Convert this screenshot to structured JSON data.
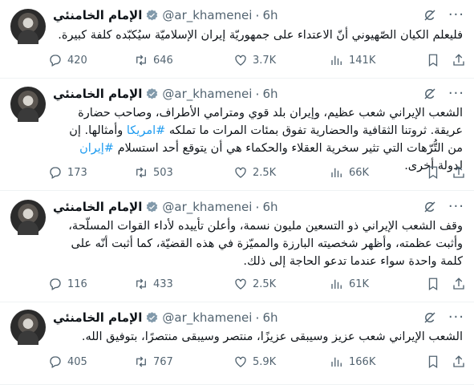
{
  "tweets": [
    {
      "name": "الإمام الخامنئي",
      "handle": "@ar_khamenei",
      "time": "6h",
      "text": "فليعلم الكيان الصّهيوني أنّ الاعتداء على جمهوريّة إيران الإسلاميّة سيُكبّده كلفة كبيرة.",
      "hashtags": [],
      "replies": "420",
      "retweets": "646",
      "likes": "3.7K",
      "views": "141K"
    },
    {
      "name": "الإمام الخامنئي",
      "handle": "@ar_khamenei",
      "time": "6h",
      "text_parts": [
        "الشعب الإيراني شعب عظيم، وإيران بلد قوي ومترامي الأطراف، وصاحب حضارة عريقة. ثروتنا الثقافية والحضارية تفوق بمئات المرات ما تملكه ",
        "#امريكا",
        " وأمثالها. إن من التُّرّهات التي تثير سخرية العقلاء والحكماء هي أن يتوقع أحد استسلام ",
        "#إيران",
        " لدولة أخرى."
      ],
      "replies": "173",
      "retweets": "503",
      "likes": "2.5K",
      "views": "66K"
    },
    {
      "name": "الإمام الخامنئي",
      "handle": "@ar_khamenei",
      "time": "6h",
      "text": "وقف الشعب الإيراني ذو التسعين مليون نسمة، وأعلن تأييده لأداء القوات المسلّحة، وأثبت عظمته، وأظهر شخصيته البارزة والمميّزة في هذه القضيّة، كما أثبت أنّه على كلمة واحدة سواء عندما تدعو الحاجة إلى ذلك.",
      "replies": "116",
      "retweets": "433",
      "likes": "2.5K",
      "views": "61K"
    },
    {
      "name": "الإمام الخامنئي",
      "handle": "@ar_khamenei",
      "time": "6h",
      "text": "الشعب الإيراني شعب عزيز وسيبقى عزيزًا، منتصر وسيبقى منتصرًا، بتوفيق الله.",
      "replies": "405",
      "retweets": "767",
      "likes": "5.9K",
      "views": "166K"
    }
  ],
  "colors": {
    "accent": "#1d9bf0",
    "muted": "#536471",
    "text": "#0f1419",
    "divider": "#eff3f4"
  },
  "icons": [
    "verified-badge-icon",
    "grok-icon",
    "more-icon",
    "reply-icon",
    "retweet-icon",
    "like-icon",
    "views-icon",
    "bookmark-icon",
    "share-icon"
  ]
}
